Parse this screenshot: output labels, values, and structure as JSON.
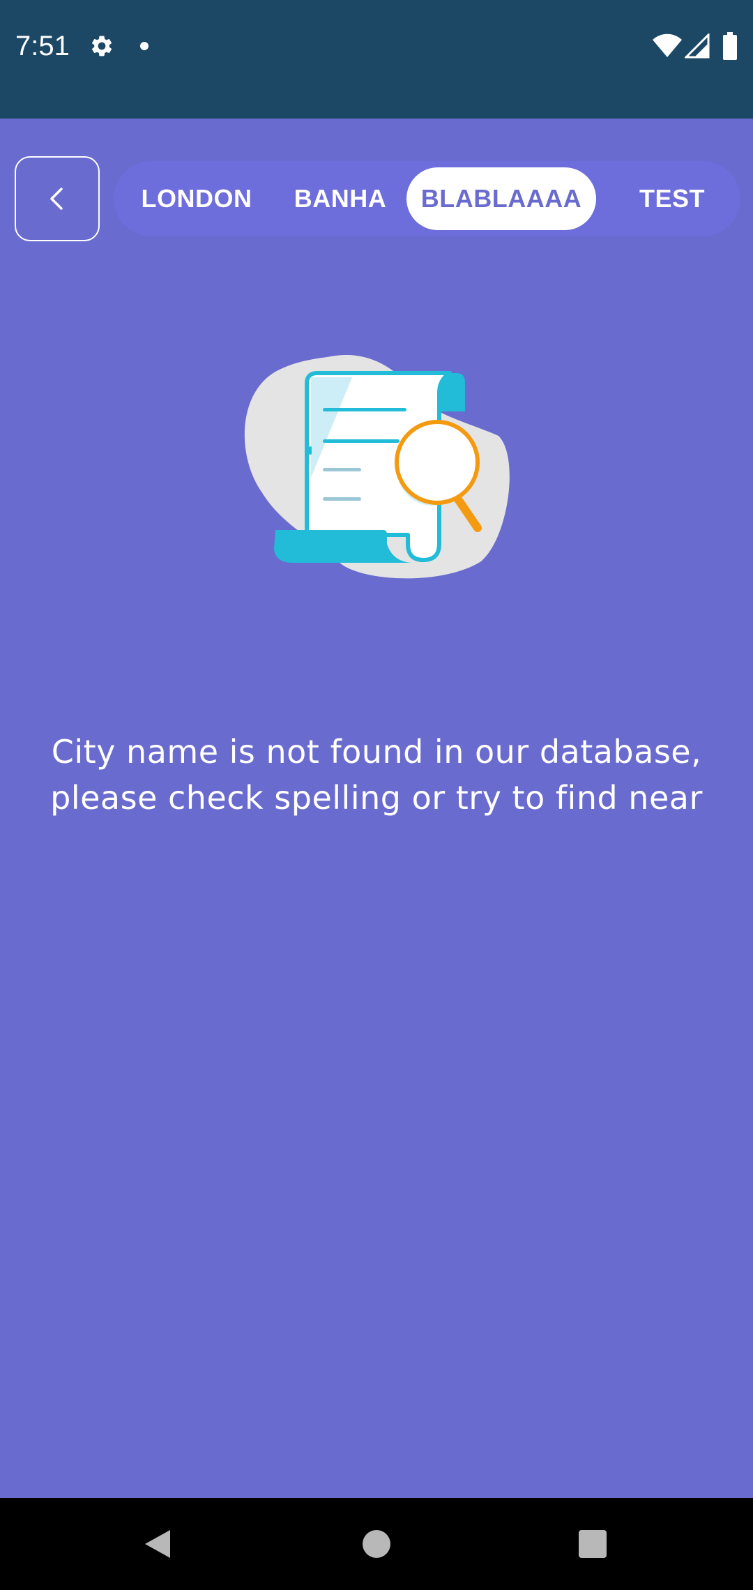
{
  "status_bar": {
    "time": "7:51",
    "icons": [
      "gear-icon",
      "notification-dot-icon",
      "wifi-icon",
      "cell-signal-icon",
      "battery-icon"
    ]
  },
  "top_bar": {
    "back_icon": "chevron-left-icon",
    "tabs": [
      {
        "label": "LONDON",
        "active": false
      },
      {
        "label": "BANHA",
        "active": false
      },
      {
        "label": "BLABLAAAA",
        "active": true
      },
      {
        "label": "TEST",
        "active": false
      }
    ]
  },
  "empty_state": {
    "illustration": "document-search-icon",
    "message_line1": "City name is not found in our database,",
    "message_line2": "please check spelling or try to find near"
  },
  "nav_bar": {
    "icons": [
      "nav-back-icon",
      "nav-home-icon",
      "nav-recents-icon"
    ]
  },
  "colors": {
    "background": "#6a6bce",
    "status_bar": "#1c4865",
    "tab_strip": "#6d6ddc",
    "active_tab_bg": "#ffffff",
    "illustration_blob": "#e4e4e4",
    "illustration_teal": "#22bcd8",
    "illustration_orange": "#f39a11",
    "nav_bar": "#000000"
  }
}
